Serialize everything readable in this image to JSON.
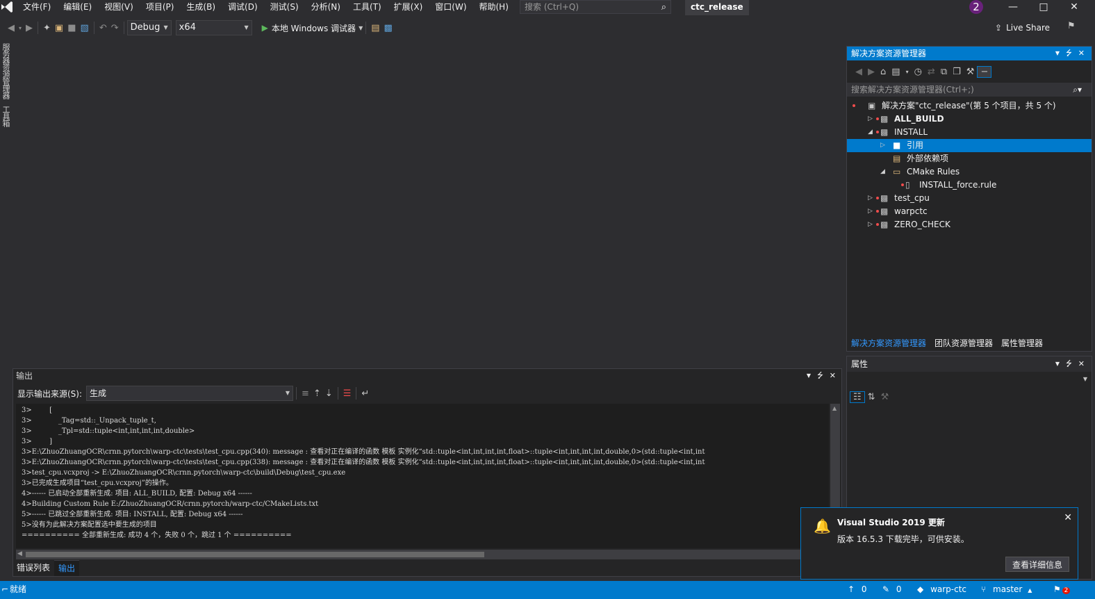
{
  "menu": [
    "文件(F)",
    "编辑(E)",
    "视图(V)",
    "项目(P)",
    "生成(B)",
    "调试(D)",
    "测试(S)",
    "分析(N)",
    "工具(T)",
    "扩展(X)",
    "窗口(W)",
    "帮助(H)"
  ],
  "search": {
    "placeholder": "搜索 (Ctrl+Q)",
    "icon": "search-icon"
  },
  "solution_title": "ctc_release",
  "notification_count": "2",
  "toolbar": {
    "config": "Debug",
    "platform": "x64",
    "debugger_label": "本地 Windows 调试器",
    "live_share": "Live Share"
  },
  "left_tabs": [
    "服务器资源管理器",
    "工具箱"
  ],
  "solution_explorer": {
    "title": "解决方案资源管理器",
    "search_placeholder": "搜索解决方案资源管理器(Ctrl+;)",
    "tree": [
      {
        "label": "解决方案\"ctc_release\"(第 5 个项目，共 5 个)",
        "level": 0,
        "expand": "",
        "bold": false,
        "icon": "solution-icon"
      },
      {
        "label": "ALL_BUILD",
        "level": 1,
        "expand": "collapsed",
        "bold": true,
        "icon": "project-icon"
      },
      {
        "label": "INSTALL",
        "level": 1,
        "expand": "expanded",
        "bold": false,
        "icon": "project-icon"
      },
      {
        "label": "引用",
        "level": 2,
        "expand": "collapsed",
        "bold": false,
        "icon": "references-icon",
        "selected": true
      },
      {
        "label": "外部依赖项",
        "level": 2,
        "expand": "",
        "bold": false,
        "icon": "external-deps-icon"
      },
      {
        "label": "CMake Rules",
        "level": 2,
        "expand": "expanded",
        "bold": false,
        "icon": "folder-icon"
      },
      {
        "label": "INSTALL_force.rule",
        "level": 3,
        "expand": "",
        "bold": false,
        "icon": "file-icon"
      },
      {
        "label": "test_cpu",
        "level": 1,
        "expand": "collapsed",
        "bold": false,
        "icon": "project-icon"
      },
      {
        "label": "warpctc",
        "level": 1,
        "expand": "collapsed",
        "bold": false,
        "icon": "project-icon"
      },
      {
        "label": "ZERO_CHECK",
        "level": 1,
        "expand": "collapsed",
        "bold": false,
        "icon": "project-icon"
      }
    ],
    "tabs": [
      "解决方案资源管理器",
      "团队资源管理器",
      "属性管理器"
    ]
  },
  "properties": {
    "title": "属性"
  },
  "output": {
    "title": "输出",
    "source_label": "显示输出来源(S):",
    "source_value": "生成",
    "lines": [
      "3>        [",
      "3>            _Tag=std::_Unpack_tuple_t,",
      "3>            _Tpl=std::tuple<int,int,int,int,double>",
      "3>        ]",
      "3>E:\\ZhuoZhuangOCR\\crnn.pytorch\\warp-ctc\\tests\\test_cpu.cpp(340): message : 查看对正在编译的函数 模板 实例化“std::tuple<int,int,int,int,float>::tuple<int,int,int,int,double,0>(std::tuple<int,int",
      "3>E:\\ZhuoZhuangOCR\\crnn.pytorch\\warp-ctc\\tests\\test_cpu.cpp(338): message : 查看对正在编译的函数 模板 实例化“std::tuple<int,int,int,int,float>::tuple<int,int,int,int,double,0>(std::tuple<int,int",
      "3>test_cpu.vcxproj -> E:\\ZhuoZhuangOCR\\crnn.pytorch\\warp-ctc\\build\\Debug\\test_cpu.exe",
      "3>已完成生成项目“test_cpu.vcxproj”的操作。",
      "4>------ 已启动全部重新生成: 项目: ALL_BUILD, 配置: Debug x64 ------",
      "4>Building Custom Rule E:/ZhuoZhuangOCR/crnn.pytorch/warp-ctc/CMakeLists.txt",
      "5>------ 已跳过全部重新生成: 项目: INSTALL, 配置: Debug x64 ------",
      "5>没有为此解决方案配置选中要生成的项目",
      "========== 全部重新生成: 成功 4 个，失败 0 个，跳过 1 个 =========="
    ]
  },
  "bottom_tabs": [
    "错误列表",
    "输出"
  ],
  "status": {
    "ready": "就绪",
    "up_count": "0",
    "edit_count": "0",
    "repo": "warp-ctc",
    "branch": "master",
    "notif_count": "2"
  },
  "toast": {
    "title": "Visual Studio 2019 更新",
    "body": "版本 16.5.3 下载完毕，可供安装。",
    "button": "查看详细信息"
  },
  "colors": {
    "accent": "#007acc",
    "background": "#2d2d30",
    "panel": "#252526",
    "badge": "#68217a"
  }
}
